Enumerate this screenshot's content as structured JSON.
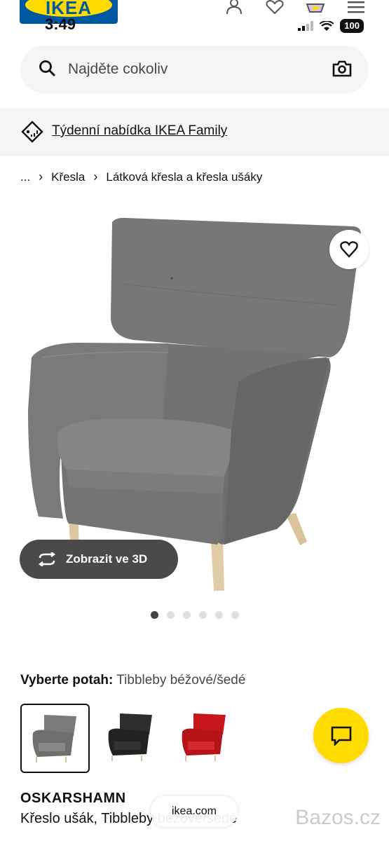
{
  "status_bar": {
    "time": "3:49",
    "battery": "100"
  },
  "logo": {
    "text": "IKEA"
  },
  "search": {
    "placeholder": "Najděte cokoliv"
  },
  "promo": {
    "text": "Týdenní nabídka IKEA Family"
  },
  "breadcrumb": {
    "ellipsis": "...",
    "items": [
      "Křesla",
      "Látková křesla a křesla ušáky"
    ]
  },
  "product": {
    "view_3d_label": "Zobrazit ve 3D",
    "image_count": 6,
    "active_image": 1,
    "cover_label": "Vyberte potah:",
    "cover_value": "Tibbleby béžové/šedé",
    "swatches": [
      {
        "color": "#7b7b7b",
        "selected": true
      },
      {
        "color": "#2a2a2a",
        "selected": false
      },
      {
        "color": "#c8171c",
        "selected": false
      }
    ],
    "name": "OSKARSHAMN",
    "description": "Křeslo ušák, Tibbleby béžové/šedé"
  },
  "browser": {
    "url": "ikea.com"
  },
  "watermark": "Bazos.cz",
  "colors": {
    "accent": "#ffdb00",
    "brand_blue": "#0058a3",
    "dark_button": "#4a4a4a"
  }
}
